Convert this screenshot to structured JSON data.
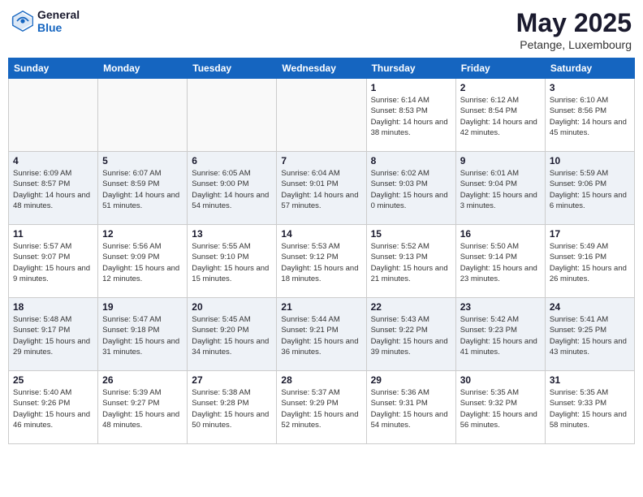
{
  "header": {
    "logo_general": "General",
    "logo_blue": "Blue",
    "month_title": "May 2025",
    "location": "Petange, Luxembourg"
  },
  "days_of_week": [
    "Sunday",
    "Monday",
    "Tuesday",
    "Wednesday",
    "Thursday",
    "Friday",
    "Saturday"
  ],
  "weeks": [
    [
      {
        "day": "",
        "empty": true
      },
      {
        "day": "",
        "empty": true
      },
      {
        "day": "",
        "empty": true
      },
      {
        "day": "",
        "empty": true
      },
      {
        "day": "1",
        "sunrise": "6:14 AM",
        "sunset": "8:53 PM",
        "daylight": "14 hours and 38 minutes."
      },
      {
        "day": "2",
        "sunrise": "6:12 AM",
        "sunset": "8:54 PM",
        "daylight": "14 hours and 42 minutes."
      },
      {
        "day": "3",
        "sunrise": "6:10 AM",
        "sunset": "8:56 PM",
        "daylight": "14 hours and 45 minutes."
      }
    ],
    [
      {
        "day": "4",
        "sunrise": "6:09 AM",
        "sunset": "8:57 PM",
        "daylight": "14 hours and 48 minutes."
      },
      {
        "day": "5",
        "sunrise": "6:07 AM",
        "sunset": "8:59 PM",
        "daylight": "14 hours and 51 minutes."
      },
      {
        "day": "6",
        "sunrise": "6:05 AM",
        "sunset": "9:00 PM",
        "daylight": "14 hours and 54 minutes."
      },
      {
        "day": "7",
        "sunrise": "6:04 AM",
        "sunset": "9:01 PM",
        "daylight": "14 hours and 57 minutes."
      },
      {
        "day": "8",
        "sunrise": "6:02 AM",
        "sunset": "9:03 PM",
        "daylight": "15 hours and 0 minutes."
      },
      {
        "day": "9",
        "sunrise": "6:01 AM",
        "sunset": "9:04 PM",
        "daylight": "15 hours and 3 minutes."
      },
      {
        "day": "10",
        "sunrise": "5:59 AM",
        "sunset": "9:06 PM",
        "daylight": "15 hours and 6 minutes."
      }
    ],
    [
      {
        "day": "11",
        "sunrise": "5:57 AM",
        "sunset": "9:07 PM",
        "daylight": "15 hours and 9 minutes."
      },
      {
        "day": "12",
        "sunrise": "5:56 AM",
        "sunset": "9:09 PM",
        "daylight": "15 hours and 12 minutes."
      },
      {
        "day": "13",
        "sunrise": "5:55 AM",
        "sunset": "9:10 PM",
        "daylight": "15 hours and 15 minutes."
      },
      {
        "day": "14",
        "sunrise": "5:53 AM",
        "sunset": "9:12 PM",
        "daylight": "15 hours and 18 minutes."
      },
      {
        "day": "15",
        "sunrise": "5:52 AM",
        "sunset": "9:13 PM",
        "daylight": "15 hours and 21 minutes."
      },
      {
        "day": "16",
        "sunrise": "5:50 AM",
        "sunset": "9:14 PM",
        "daylight": "15 hours and 23 minutes."
      },
      {
        "day": "17",
        "sunrise": "5:49 AM",
        "sunset": "9:16 PM",
        "daylight": "15 hours and 26 minutes."
      }
    ],
    [
      {
        "day": "18",
        "sunrise": "5:48 AM",
        "sunset": "9:17 PM",
        "daylight": "15 hours and 29 minutes."
      },
      {
        "day": "19",
        "sunrise": "5:47 AM",
        "sunset": "9:18 PM",
        "daylight": "15 hours and 31 minutes."
      },
      {
        "day": "20",
        "sunrise": "5:45 AM",
        "sunset": "9:20 PM",
        "daylight": "15 hours and 34 minutes."
      },
      {
        "day": "21",
        "sunrise": "5:44 AM",
        "sunset": "9:21 PM",
        "daylight": "15 hours and 36 minutes."
      },
      {
        "day": "22",
        "sunrise": "5:43 AM",
        "sunset": "9:22 PM",
        "daylight": "15 hours and 39 minutes."
      },
      {
        "day": "23",
        "sunrise": "5:42 AM",
        "sunset": "9:23 PM",
        "daylight": "15 hours and 41 minutes."
      },
      {
        "day": "24",
        "sunrise": "5:41 AM",
        "sunset": "9:25 PM",
        "daylight": "15 hours and 43 minutes."
      }
    ],
    [
      {
        "day": "25",
        "sunrise": "5:40 AM",
        "sunset": "9:26 PM",
        "daylight": "15 hours and 46 minutes."
      },
      {
        "day": "26",
        "sunrise": "5:39 AM",
        "sunset": "9:27 PM",
        "daylight": "15 hours and 48 minutes."
      },
      {
        "day": "27",
        "sunrise": "5:38 AM",
        "sunset": "9:28 PM",
        "daylight": "15 hours and 50 minutes."
      },
      {
        "day": "28",
        "sunrise": "5:37 AM",
        "sunset": "9:29 PM",
        "daylight": "15 hours and 52 minutes."
      },
      {
        "day": "29",
        "sunrise": "5:36 AM",
        "sunset": "9:31 PM",
        "daylight": "15 hours and 54 minutes."
      },
      {
        "day": "30",
        "sunrise": "5:35 AM",
        "sunset": "9:32 PM",
        "daylight": "15 hours and 56 minutes."
      },
      {
        "day": "31",
        "sunrise": "5:35 AM",
        "sunset": "9:33 PM",
        "daylight": "15 hours and 58 minutes."
      }
    ]
  ],
  "labels": {
    "sunrise_label": "Sunrise:",
    "sunset_label": "Sunset:",
    "daylight_label": "Daylight:"
  }
}
